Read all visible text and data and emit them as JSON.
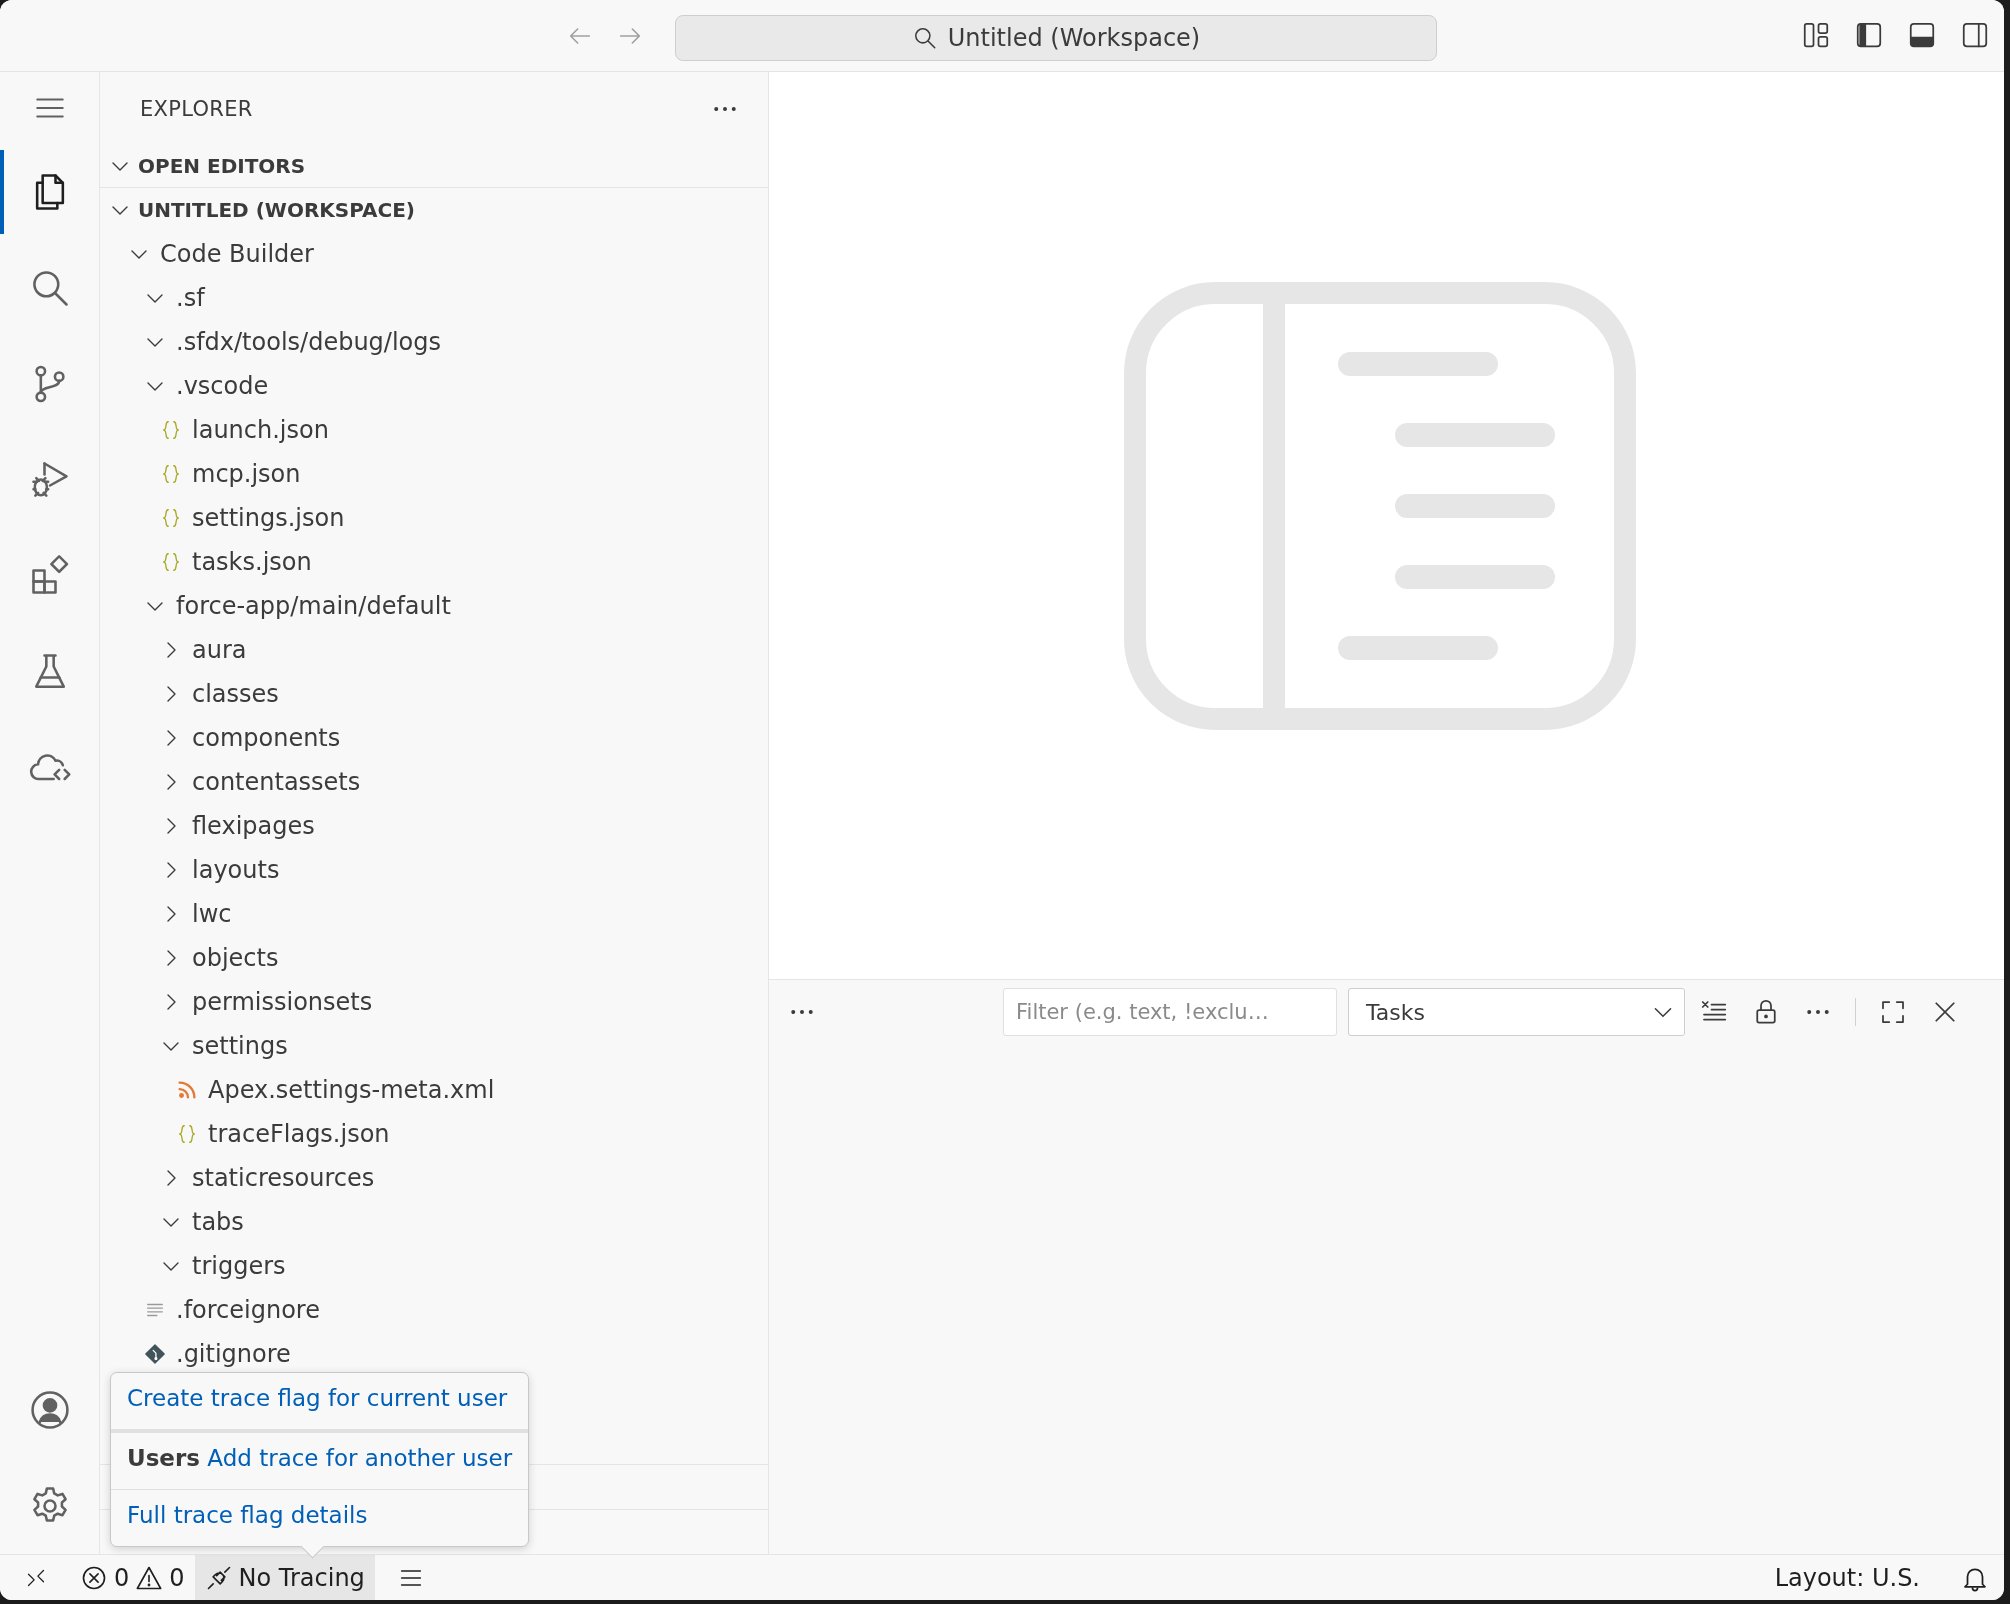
{
  "title_bar": {
    "nav": [
      {
        "kind": "back",
        "disabled": true
      },
      {
        "kind": "forward",
        "disabled": true
      }
    ],
    "command_center": "Untitled (Workspace)"
  },
  "activity_bar": {
    "items": [
      {
        "kind": "explorer",
        "selected": true
      },
      {
        "kind": "search",
        "selected": false
      },
      {
        "kind": "source-control",
        "selected": false
      },
      {
        "kind": "run-debug",
        "selected": false
      },
      {
        "kind": "extensions",
        "selected": false
      },
      {
        "kind": "testing",
        "selected": false
      },
      {
        "kind": "cloud-code",
        "selected": false
      }
    ],
    "bottom": [
      {
        "kind": "account"
      },
      {
        "kind": "settings"
      }
    ]
  },
  "sidebar": {
    "title": "EXPLORER",
    "sections": [
      {
        "title": "OPEN EDITORS",
        "expanded": true
      },
      {
        "title": "UNTITLED (WORKSPACE)",
        "expanded": true,
        "tree": [
          {
            "name": "Code Builder",
            "kind": "folder",
            "expanded": true,
            "children": [
              {
                "name": ".sf",
                "kind": "folder",
                "expanded": true
              },
              {
                "name": ".sfdx/tools/debug/logs",
                "kind": "folder",
                "expanded": true
              },
              {
                "name": ".vscode",
                "kind": "folder",
                "expanded": true,
                "children": [
                  {
                    "name": "launch.json",
                    "kind": "json"
                  },
                  {
                    "name": "mcp.json",
                    "kind": "json"
                  },
                  {
                    "name": "settings.json",
                    "kind": "json"
                  },
                  {
                    "name": "tasks.json",
                    "kind": "json"
                  }
                ]
              },
              {
                "name": "force-app/main/default",
                "kind": "folder",
                "expanded": true,
                "children": [
                  {
                    "name": "aura",
                    "kind": "folder",
                    "expanded": false
                  },
                  {
                    "name": "classes",
                    "kind": "folder",
                    "expanded": false
                  },
                  {
                    "name": "components",
                    "kind": "folder",
                    "expanded": false
                  },
                  {
                    "name": "contentassets",
                    "kind": "folder",
                    "expanded": false
                  },
                  {
                    "name": "flexipages",
                    "kind": "folder",
                    "expanded": false
                  },
                  {
                    "name": "layouts",
                    "kind": "folder",
                    "expanded": false
                  },
                  {
                    "name": "lwc",
                    "kind": "folder",
                    "expanded": false
                  },
                  {
                    "name": "objects",
                    "kind": "folder",
                    "expanded": false
                  },
                  {
                    "name": "permissionsets",
                    "kind": "folder",
                    "expanded": false
                  },
                  {
                    "name": "settings",
                    "kind": "folder",
                    "expanded": true,
                    "children": [
                      {
                        "name": "Apex.settings-meta.xml",
                        "kind": "xml"
                      },
                      {
                        "name": "traceFlags.json",
                        "kind": "json"
                      }
                    ]
                  },
                  {
                    "name": "staticresources",
                    "kind": "folder",
                    "expanded": false
                  },
                  {
                    "name": "tabs",
                    "kind": "folder",
                    "expanded": true
                  },
                  {
                    "name": "triggers",
                    "kind": "folder",
                    "expanded": true
                  }
                ]
              },
              {
                "name": ".forceignore",
                "kind": "text"
              },
              {
                "name": ".gitignore",
                "kind": "git"
              }
            ]
          }
        ]
      }
    ]
  },
  "panel": {
    "filter": {
      "placeholder": "Filter (e.g. text, !exclu…"
    },
    "dropdown": {
      "value": "Tasks"
    }
  },
  "status_bar": {
    "errors": "0",
    "warnings": "0",
    "tracing": {
      "text": "No Tracing",
      "hovered": true
    },
    "layout": "Layout: U.S."
  },
  "hover": {
    "sections": [
      {
        "kind": "link",
        "text": "Create trace flag for current user"
      },
      {
        "kind": "labeled-link",
        "label": "Users",
        "text": "Add trace for another user"
      },
      {
        "kind": "link",
        "text": "Full trace flag details"
      }
    ]
  }
}
